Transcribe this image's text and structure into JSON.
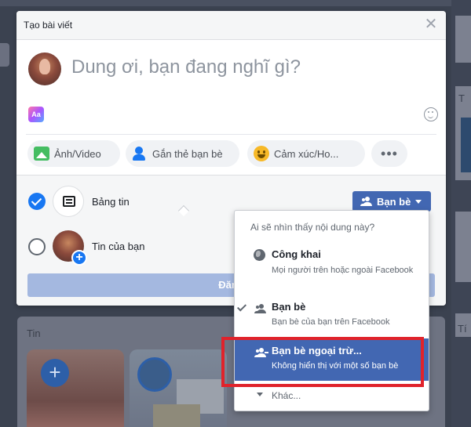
{
  "dialog": {
    "title": "Tạo bài viết",
    "close_glyph": "✕",
    "composer_placeholder": "Dung ơi, bạn đang nghĩ gì?",
    "text_format_glyph": "Aa",
    "actions": {
      "photo_label": "Ảnh/Video",
      "tag_label": "Gắn thẻ bạn bè",
      "feeling_label": "Cảm xúc/Ho...",
      "more_glyph": "•••"
    },
    "feed_label": "Bảng tin",
    "story_label": "Tin của bạn",
    "audience_label": "Bạn bè",
    "share_label": "Đăng",
    "add_glyph": "+"
  },
  "dropdown": {
    "header": "Ai sẽ nhìn thấy nội dung này?",
    "items": [
      {
        "title": "Công khai",
        "desc": "Mọi người trên hoặc ngoài Facebook"
      },
      {
        "title": "Bạn bè",
        "desc": "Bạn bè của bạn trên Facebook"
      },
      {
        "title": "Bạn bè ngoại trừ...",
        "desc": "Không hiển thị với một số bạn bè"
      }
    ],
    "more_label": "Khác..."
  },
  "background": {
    "stories_label": "Tin",
    "right_label": "T",
    "right_label2": "Tí"
  },
  "colors": {
    "accent": "#4267b2",
    "highlight_box": "#e0232b",
    "check_blue": "#1877f2"
  }
}
